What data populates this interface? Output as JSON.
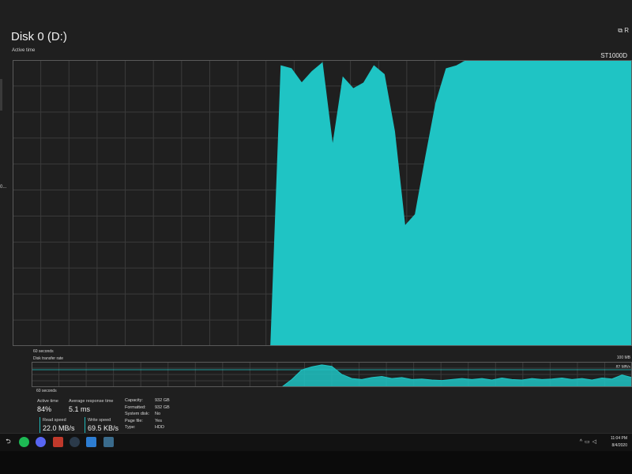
{
  "window": {
    "title": "Disk 0 (D:)",
    "subtitle": "Active time",
    "model": "ST1000D",
    "corner_label": "R",
    "left_edge_text": "0..."
  },
  "main_chart": {
    "time_label": "60 seconds",
    "fill_color": "#1fc4c4"
  },
  "transfer_chart": {
    "title": "Disk transfer rate",
    "time_label": "60 seconds",
    "max_label": "100 MB",
    "mid_label": "82 MB/s",
    "line_color": "#1fc4c4"
  },
  "stats": {
    "active_time": {
      "label": "Active time",
      "value": "84%"
    },
    "avg_response": {
      "label": "Average response time",
      "value": "5.1 ms"
    },
    "read_speed": {
      "label": "Read speed",
      "value": "22.0 MB/s"
    },
    "write_speed": {
      "label": "Write speed",
      "value": "69.5 KB/s"
    },
    "props": [
      {
        "label": "Capacity:",
        "value": "932 GB"
      },
      {
        "label": "Formatted:",
        "value": "932 GB"
      },
      {
        "label": "System disk:",
        "value": "No"
      },
      {
        "label": "Page file:",
        "value": "Yes"
      },
      {
        "label": "Type:",
        "value": "HDD"
      }
    ]
  },
  "taskbar": {
    "clock_time": "11:04 PM",
    "clock_date": "8/4/2020",
    "icons": [
      "back-icon",
      "spotify-icon",
      "discord-icon",
      "game-icon",
      "steam-icon",
      "app-icon",
      "task-manager-icon"
    ]
  },
  "chart_data": [
    {
      "type": "area",
      "title": "Active time",
      "x": [
        60,
        59,
        58,
        57,
        56,
        55,
        54,
        53,
        52,
        51,
        50,
        49,
        48,
        47,
        46,
        45,
        44,
        43,
        42,
        41,
        40,
        39,
        38,
        37,
        36,
        35,
        34,
        33,
        32,
        31,
        30,
        29,
        28,
        27,
        26,
        25,
        24,
        23,
        22,
        21,
        20,
        19,
        18,
        17,
        16,
        15,
        14,
        13,
        12,
        11,
        10,
        9,
        8,
        7,
        6,
        5,
        4,
        3,
        2,
        1,
        0
      ],
      "values": [
        0,
        0,
        0,
        0,
        0,
        0,
        0,
        0,
        0,
        0,
        0,
        0,
        0,
        0,
        0,
        0,
        0,
        0,
        0,
        0,
        0,
        0,
        0,
        0,
        0,
        0,
        98,
        97,
        92,
        96,
        99,
        70,
        94,
        90,
        92,
        98,
        95,
        75,
        42,
        46,
        66,
        85,
        97,
        98,
        100,
        100,
        100,
        100,
        100,
        100,
        100,
        100,
        100,
        100,
        100,
        100,
        100,
        100,
        100,
        100,
        100
      ],
      "ylim": [
        0,
        100
      ],
      "xlabel": "60 seconds",
      "grid": true,
      "color": "#1fc4c4"
    },
    {
      "type": "area",
      "title": "Disk transfer rate",
      "x": [
        60,
        59,
        58,
        57,
        56,
        55,
        54,
        53,
        52,
        51,
        50,
        49,
        48,
        47,
        46,
        45,
        44,
        43,
        42,
        41,
        40,
        39,
        38,
        37,
        36,
        35,
        34,
        33,
        32,
        31,
        30,
        29,
        28,
        27,
        26,
        25,
        24,
        23,
        22,
        21,
        20,
        19,
        18,
        17,
        16,
        15,
        14,
        13,
        12,
        11,
        10,
        9,
        8,
        7,
        6,
        5,
        4,
        3,
        2,
        1,
        0
      ],
      "values": [
        0,
        0,
        0,
        0,
        0,
        0,
        0,
        0,
        0,
        0,
        0,
        0,
        0,
        0,
        0,
        0,
        0,
        0,
        0,
        0,
        0,
        0,
        0,
        0,
        0,
        0,
        30,
        68,
        80,
        88,
        82,
        50,
        34,
        30,
        38,
        42,
        34,
        38,
        30,
        32,
        28,
        26,
        30,
        34,
        30,
        34,
        28,
        36,
        30,
        28,
        34,
        30,
        32,
        36,
        30,
        34,
        28,
        36,
        32,
        48,
        38
      ],
      "ylim": [
        0,
        100
      ],
      "xlabel": "60 seconds",
      "grid": true,
      "color": "#1fc4c4"
    }
  ]
}
